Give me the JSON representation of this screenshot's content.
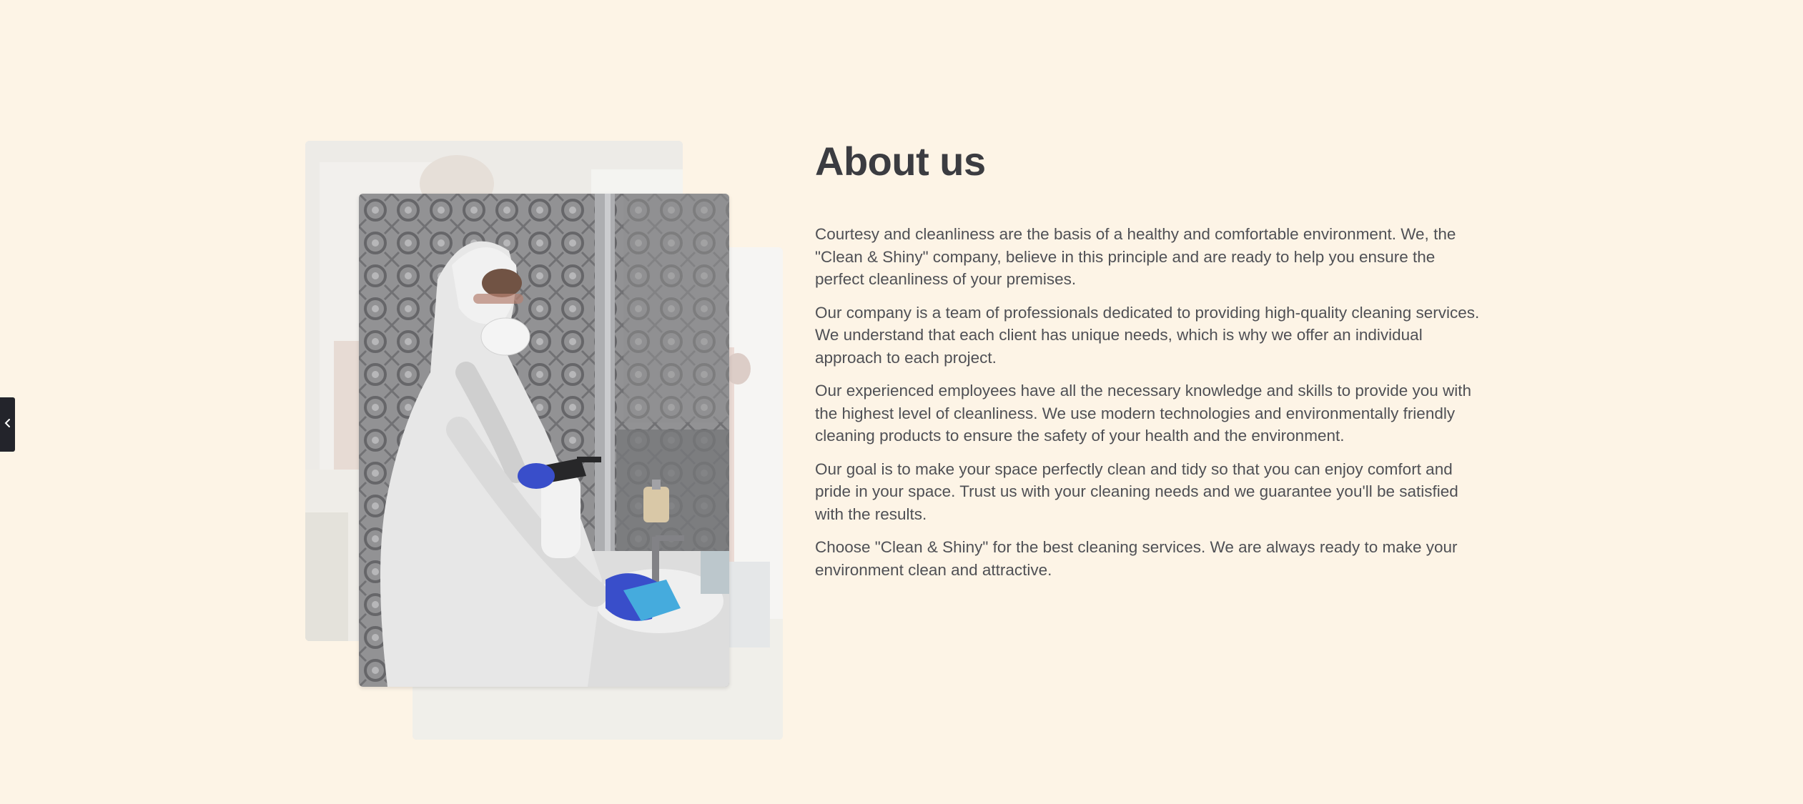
{
  "sidebar_toggle": {
    "icon": "chevron-left-icon"
  },
  "gallery": {
    "images": [
      {
        "name": "cleaner-in-bright-room",
        "position": "back-left"
      },
      {
        "name": "cleaner-in-protective-suit-sanitizing-sink",
        "position": "front"
      },
      {
        "name": "cleaner-in-red-near-window",
        "position": "back-right"
      }
    ]
  },
  "about": {
    "title": "About us",
    "paragraphs": [
      "Courtesy and cleanliness are the basis of a healthy and comfortable environment. We, the \"Clean & Shiny\" company, believe in this principle and are ready to help you ensure the perfect cleanliness of your premises.",
      "Our company is a team of professionals dedicated to providing high-quality cleaning services. We understand that each client has unique needs, which is why we offer an individual approach to each project.",
      "Our experienced employees have all the necessary knowledge and skills to provide you with the highest level of cleanliness. We use modern technologies and environmentally friendly cleaning products to ensure the safety of your health and the environment.",
      "Our goal is to make your space perfectly clean and tidy so that you can enjoy comfort and pride in your space. Trust us with your cleaning needs and we guarantee you'll be satisfied with the results.",
      "Choose \"Clean & Shiny\" for the best cleaning services. We are always ready to make your environment clean and attractive."
    ]
  },
  "colors": {
    "background": "#fdf4e6",
    "heading": "#3b3c41",
    "text": "#4f5055",
    "glove_blue": "#2f45c8",
    "toggle_bg": "#23242b"
  }
}
